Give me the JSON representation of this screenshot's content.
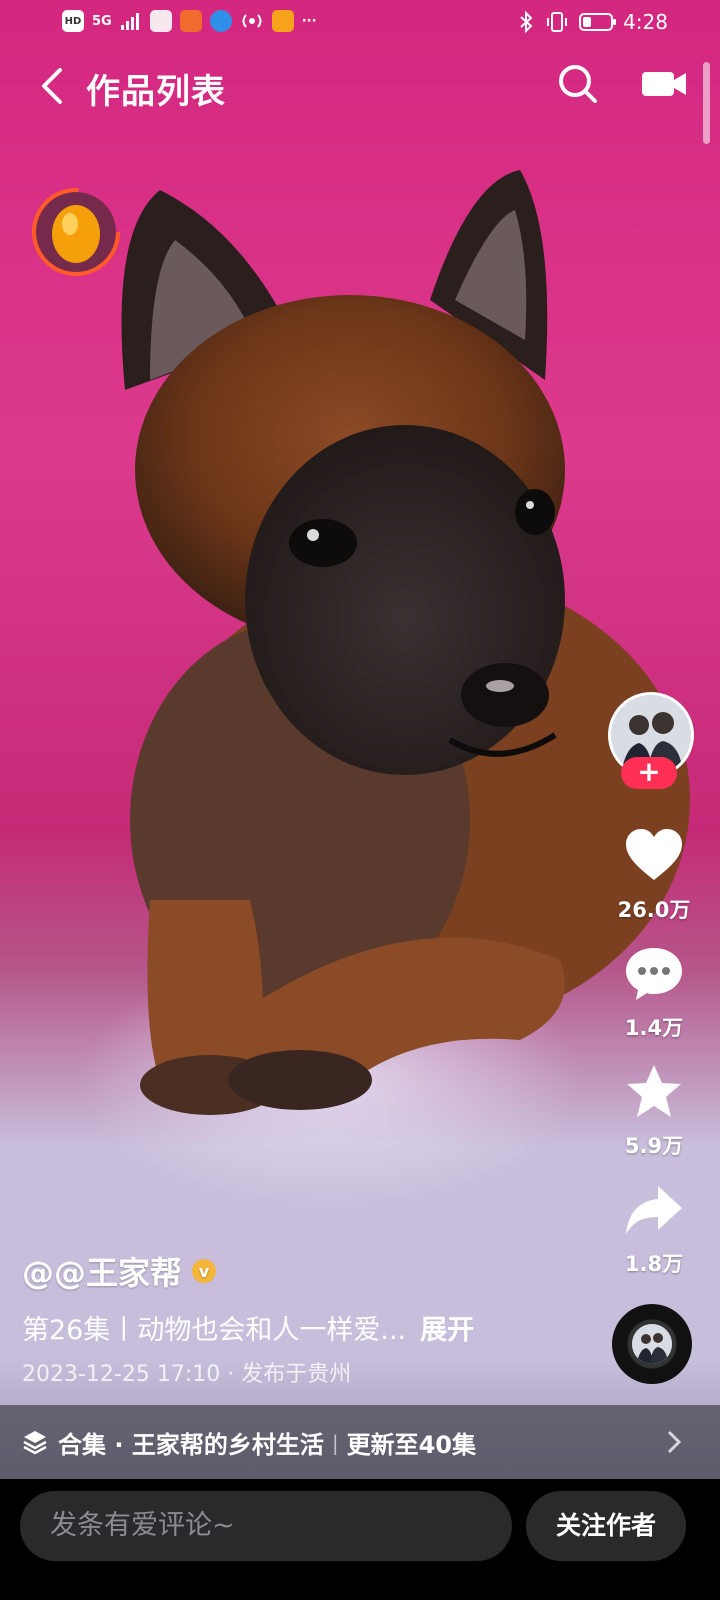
{
  "status_bar": {
    "hd": "HD",
    "network": "5G",
    "time": "4:28",
    "more": "···",
    "battery_level": 0.3
  },
  "nav": {
    "title": "作品列表"
  },
  "actions": {
    "like_count": "26.0万",
    "comment_count": "1.4万",
    "favorite_count": "5.9万",
    "share_count": "1.8万"
  },
  "post": {
    "author": "@@王家帮",
    "caption": "第26集丨动物也会和人一样爱...",
    "expand_label": "展开",
    "meta": "2023-12-25 17:10 · 发布于贵州"
  },
  "collection": {
    "label": "合集 · 王家帮的乡村生活",
    "update": "更新至40集"
  },
  "bottom": {
    "comment_placeholder": "发条有爱评论~",
    "follow_label": "关注作者"
  },
  "colors": {
    "accent": "#ff2f55",
    "verified": "#f3b53a"
  }
}
